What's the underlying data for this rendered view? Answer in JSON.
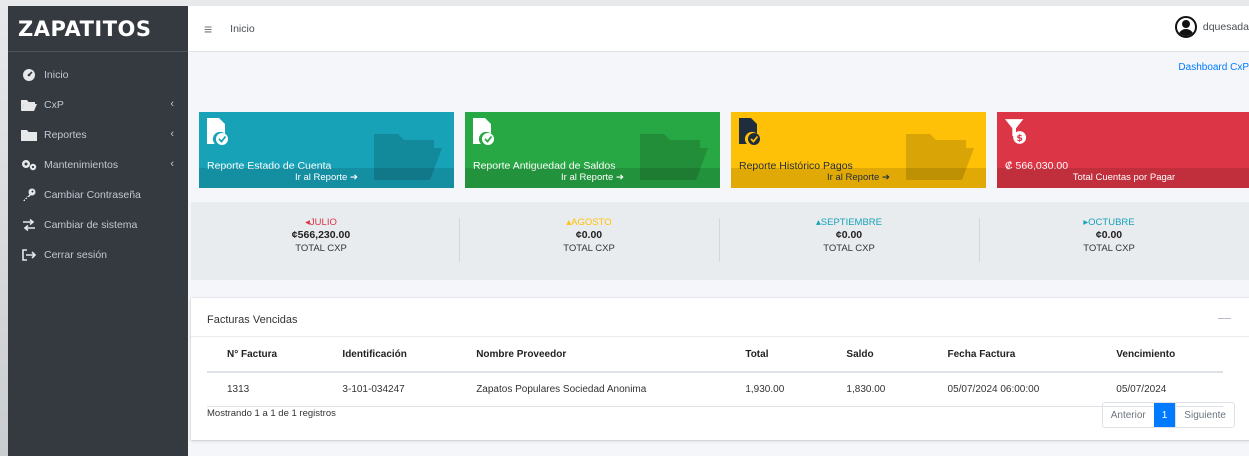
{
  "brand": {
    "name": "ZAPATITOS"
  },
  "sidebar": {
    "items": [
      {
        "label": "Inicio",
        "icon": "tachometer-icon",
        "has_submenu": false
      },
      {
        "label": "CxP",
        "icon": "folder-open-icon",
        "has_submenu": true
      },
      {
        "label": "Reportes",
        "icon": "folder-icon",
        "has_submenu": true
      },
      {
        "label": "Mantenimientos",
        "icon": "gears-icon",
        "has_submenu": true
      },
      {
        "label": "Cambiar Contraseña",
        "icon": "key-icon",
        "has_submenu": false
      },
      {
        "label": "Cambiar de sistema",
        "icon": "exchange-icon",
        "has_submenu": false
      },
      {
        "label": "Cerrar sesión",
        "icon": "sign-out-icon",
        "has_submenu": false
      }
    ]
  },
  "topbar": {
    "breadcrumb": "Inicio",
    "username": "dquesada"
  },
  "dashboard_link": "Dashboard CxP",
  "info_boxes": [
    {
      "title": "Reporte Estado de Cuenta",
      "footer": "Ir al Reporte",
      "color": "#17a2b8"
    },
    {
      "title": "Reporte Antiguedad de Saldos",
      "footer": "Ir al Reporte",
      "color": "#28a745"
    },
    {
      "title": "Reporte Histórico Pagos",
      "footer": "Ir al Reporte",
      "color": "#ffc107"
    },
    {
      "title": "₡ 566,030.00",
      "footer": "Total Cuentas por Pagar",
      "color": "#dc3545"
    }
  ],
  "months": [
    {
      "name": "JULIO",
      "amount": "¢566,230.00",
      "label": "TOTAL CXP",
      "trend": "left",
      "color": "#dc3545"
    },
    {
      "name": "AGOSTO",
      "amount": "¢0.00",
      "label": "TOTAL CXP",
      "trend": "up",
      "color": "#ffc107"
    },
    {
      "name": "SEPTIEMBRE",
      "amount": "¢0.00",
      "label": "TOTAL CXP",
      "trend": "up",
      "color": "#17a2b8"
    },
    {
      "name": "OCTUBRE",
      "amount": "¢0.00",
      "label": "TOTAL CXP",
      "trend": "right",
      "color": "#17a2b8"
    }
  ],
  "facturas": {
    "title": "Facturas Vencidas",
    "collapse_symbol": "—",
    "columns": [
      "N° Factura",
      "Identificación",
      "Nombre Proveedor",
      "Total",
      "Saldo",
      "Fecha Factura",
      "Vencimiento"
    ],
    "rows": [
      [
        "1313",
        "3-101-034247",
        "Zapatos Populares Sociedad Anonima",
        "1,930.00",
        "1,830.00",
        "05/07/2024 06:00:00",
        "05/07/2024"
      ]
    ],
    "info": "Mostrando 1 a 1 de 1 registros",
    "pagination": {
      "prev": "Anterior",
      "current": "1",
      "next": "Siguiente"
    }
  }
}
